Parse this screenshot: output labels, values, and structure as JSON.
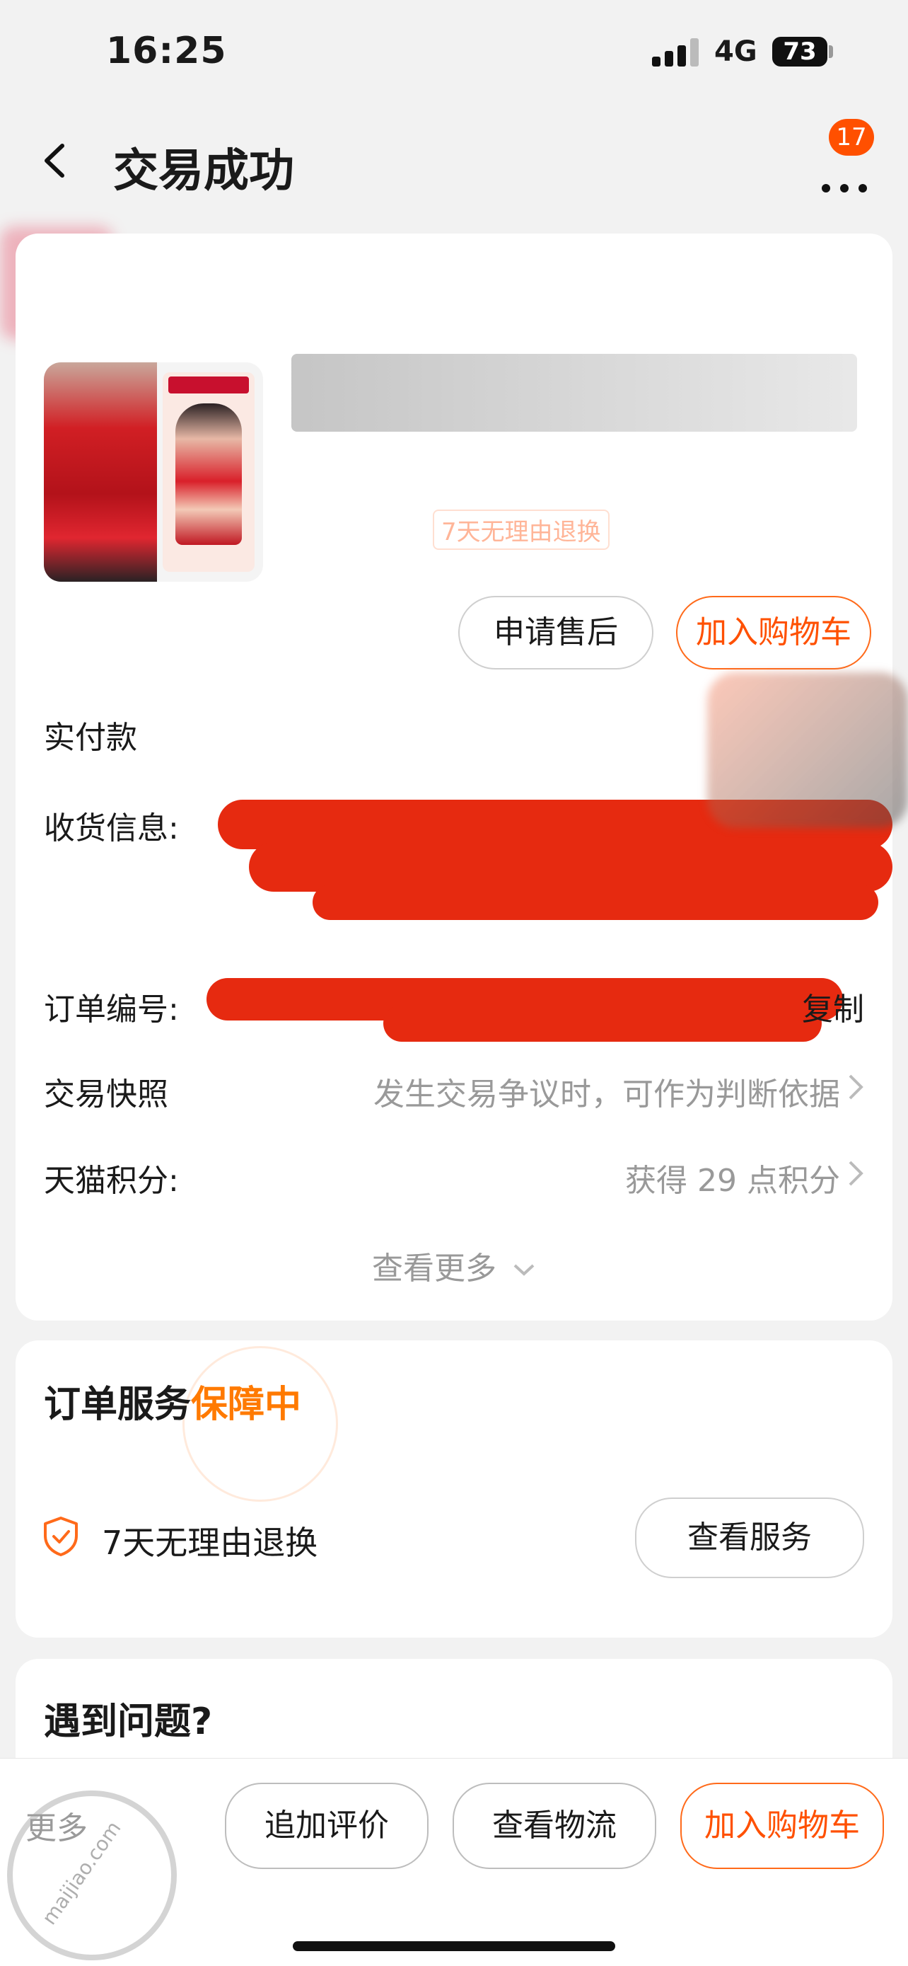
{
  "status_bar": {
    "time": "16:25",
    "network": "4G",
    "battery": "73"
  },
  "nav": {
    "title": "交易成功",
    "badge_count": "17"
  },
  "product": {
    "title": "",
    "return_tag": "7天无理由退换"
  },
  "order_actions": {
    "after_sale": "申请售后",
    "add_to_cart": "加入购物车"
  },
  "rows": {
    "paid_label": "实付款",
    "shipping_label": "收货信息:",
    "order_no_label": "订单编号:",
    "copy": "复制",
    "snapshot_label": "交易快照",
    "snapshot_value": "发生交易争议时，可作为判断依据",
    "points_label": "天猫积分:",
    "points_value": "获得 29 点积分",
    "see_more": "查看更多"
  },
  "service": {
    "title_prefix": "订单服务",
    "title_highlight": "保障中",
    "item": "7天无理由退换",
    "view_button": "查看服务"
  },
  "problem": {
    "title": "遇到问题?"
  },
  "bottom_bar": {
    "more": "更多",
    "review": "追加评价",
    "logistics": "查看物流",
    "add_to_cart": "加入购物车"
  },
  "watermark": "maijiao.com",
  "colors": {
    "accent": "#ff5000",
    "highlight": "#ff7a00",
    "background": "#f2f2f2"
  }
}
